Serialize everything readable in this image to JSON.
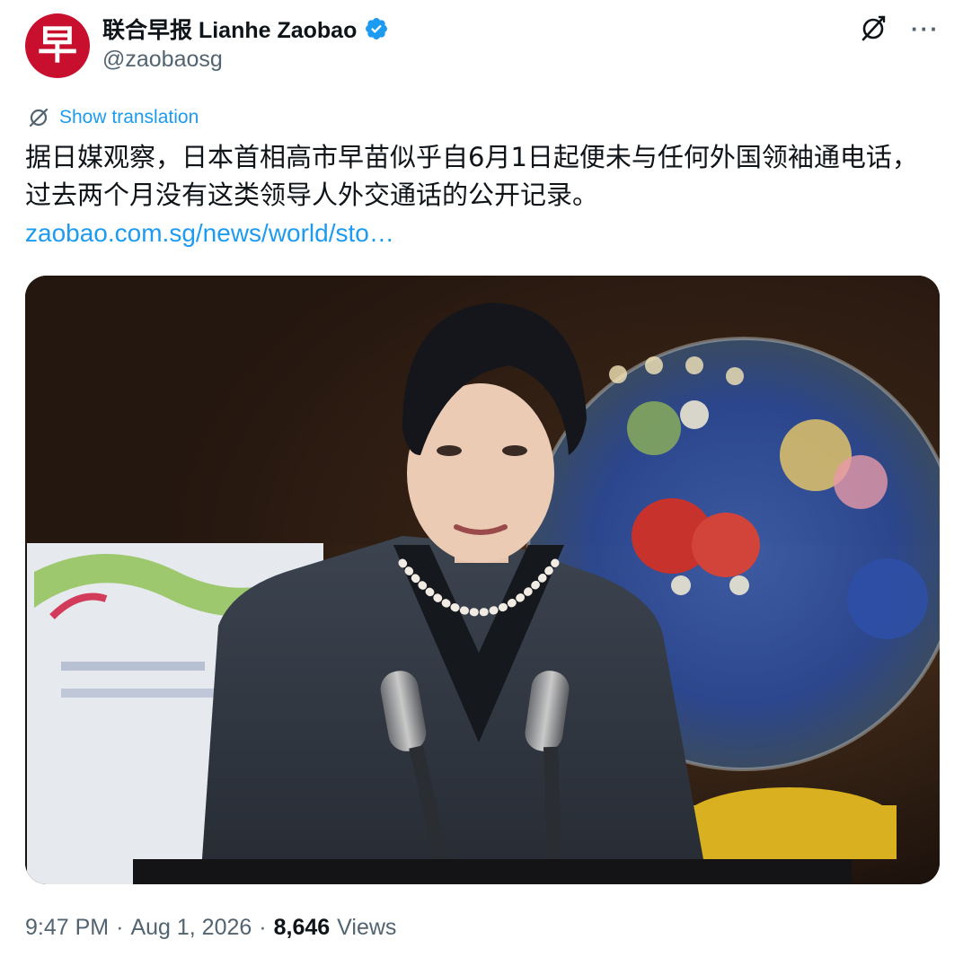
{
  "account": {
    "avatar_text": "早",
    "display_name": "联合早报 Lianhe Zaobao",
    "handle": "@zaobaosg",
    "verified": true
  },
  "actions": {
    "grok_icon": "grok-slash-icon",
    "more_icon": "more-icon",
    "more_label": "···"
  },
  "translation": {
    "label": "Show translation"
  },
  "tweet": {
    "text": "据日媒观察，日本首相高市早苗似乎自6月1日起便未与任何外国领袖通电话，过去两个月没有这类领导人外交通话的公开记录。",
    "link": "zaobao.com.sg/news/world/sto…"
  },
  "media": {
    "description_icon": "photo"
  },
  "meta": {
    "time": "9:47 PM",
    "sep1": "·",
    "date": "Aug 1, 2026",
    "sep2": "·",
    "views_count": "8,646",
    "views_label": "Views"
  },
  "colors": {
    "accent": "#1d9bf0",
    "avatar_bg": "#c8102e",
    "secondary_text": "#536471"
  }
}
